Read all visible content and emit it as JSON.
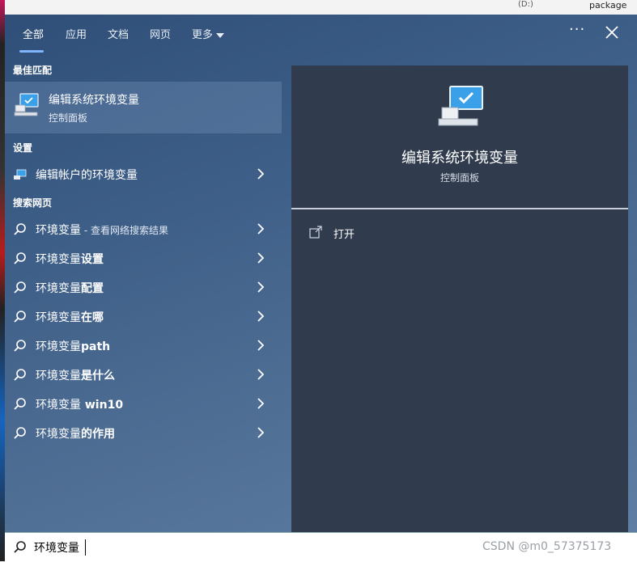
{
  "background": {
    "top_right_text": "package",
    "top_mid_text": "(D:)"
  },
  "tabs": [
    {
      "label": "全部",
      "active": true
    },
    {
      "label": "应用",
      "active": false
    },
    {
      "label": "文档",
      "active": false
    },
    {
      "label": "网页",
      "active": false
    },
    {
      "label": "更多",
      "active": false
    }
  ],
  "header": {
    "more_options": "···"
  },
  "best_match": {
    "heading": "最佳匹配",
    "title": "编辑系统环境变量",
    "subtitle": "控制面板"
  },
  "settings": {
    "heading": "设置",
    "items": [
      {
        "label": "编辑帐户的环境变量"
      }
    ]
  },
  "web": {
    "heading": "搜索网页",
    "items": [
      {
        "prefix": "环境变量",
        "suffix": "",
        "hint": " - 查看网络搜索结果"
      },
      {
        "prefix": "环境变量",
        "suffix": "设置",
        "hint": ""
      },
      {
        "prefix": "环境变量",
        "suffix": "配置",
        "hint": ""
      },
      {
        "prefix": "环境变量",
        "suffix": "在哪",
        "hint": ""
      },
      {
        "prefix": "环境变量",
        "suffix": "path",
        "hint": ""
      },
      {
        "prefix": "环境变量",
        "suffix": "是什么",
        "hint": ""
      },
      {
        "prefix": "环境变量",
        "suffix": " win10",
        "hint": ""
      },
      {
        "prefix": "环境变量",
        "suffix": "的作用",
        "hint": ""
      }
    ]
  },
  "preview": {
    "title": "编辑系统环境变量",
    "subtitle": "控制面板",
    "actions": [
      {
        "label": "打开"
      }
    ]
  },
  "search": {
    "value": "环境变量"
  },
  "watermark": "CSDN @m0_57375173",
  "colors": {
    "accent": "#7fb4ff",
    "preview_bg": "#303c4d"
  }
}
